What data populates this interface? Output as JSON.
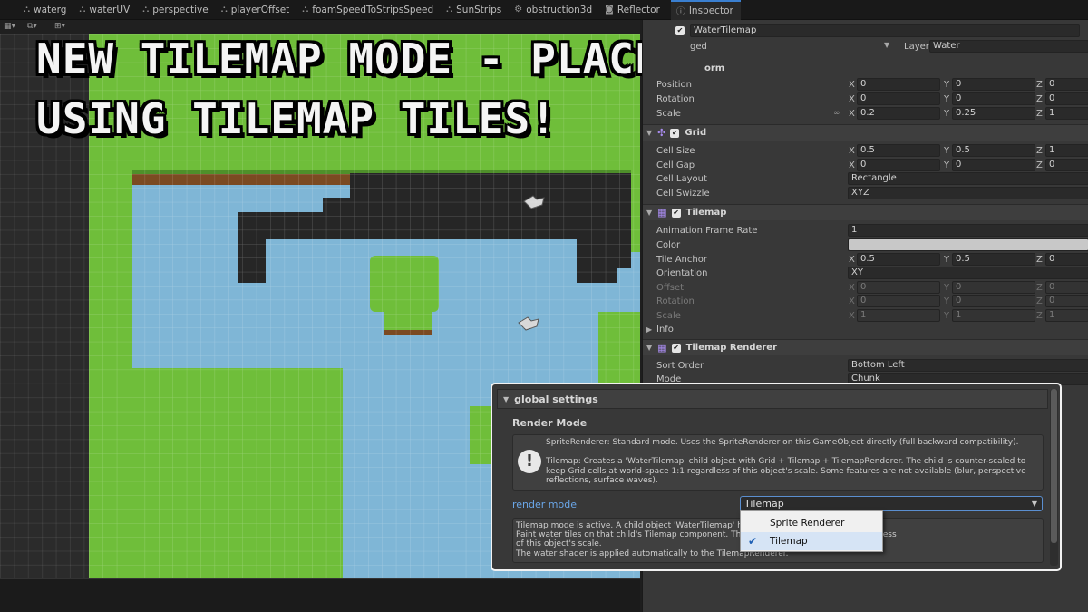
{
  "tabs": [
    {
      "label": "waterg",
      "icon": "shader-icon"
    },
    {
      "label": "waterUV",
      "icon": "shader-icon"
    },
    {
      "label": "perspective",
      "icon": "shader-icon"
    },
    {
      "label": "playerOffset",
      "icon": "shader-icon"
    },
    {
      "label": "foamSpeedToStripsSpeed",
      "icon": "shader-icon"
    },
    {
      "label": "SunStrips",
      "icon": "shader-icon"
    },
    {
      "label": "obstruction3d",
      "icon": "gear-icon"
    },
    {
      "label": "Reflector",
      "icon": "camera-icon"
    },
    {
      "label": "Inspector",
      "icon": "info-icon"
    }
  ],
  "overlay_title": {
    "line1": "NEW TILEMAP MODE - PLACE WATER",
    "line2": "USING TILEMAP TILES!"
  },
  "inspector": {
    "object_name": "WaterTilemap",
    "tag_label": "ged",
    "layer_label": "Layer",
    "layer_value": "Water",
    "transform_header_fragment": "orm",
    "transform": {
      "position_label": "Position",
      "rotation_label": "Rotation",
      "scale_label": "Scale",
      "position": [
        "0",
        "0",
        "0"
      ],
      "rotation": [
        "0",
        "0",
        "0"
      ],
      "scale": [
        "0.2",
        "0.25",
        "1"
      ]
    },
    "grid": {
      "header": "Grid",
      "cell_size_label": "Cell Size",
      "cell_size": [
        "0.5",
        "0.5",
        "1"
      ],
      "cell_gap_label": "Cell Gap",
      "cell_gap": [
        "0",
        "0",
        "0"
      ],
      "cell_layout_label": "Cell Layout",
      "cell_layout": "Rectangle",
      "cell_swizzle_label": "Cell Swizzle",
      "cell_swizzle": "XYZ"
    },
    "tilemap": {
      "header": "Tilemap",
      "animation_frame_rate_label": "Animation Frame Rate",
      "animation_frame_rate": "1",
      "color_label": "Color",
      "color_value": "#c8c8c8",
      "tile_anchor_label": "Tile Anchor",
      "tile_anchor": [
        "0.5",
        "0.5",
        "0"
      ],
      "orientation_label": "Orientation",
      "orientation": "XY",
      "offset_label": "Offset",
      "offset": [
        "0",
        "0",
        "0"
      ],
      "rotation_label": "Rotation",
      "rotation": [
        "0",
        "0",
        "0"
      ],
      "scale_label": "Scale",
      "scale": [
        "1",
        "1",
        "1"
      ],
      "info_label": "Info"
    },
    "renderer": {
      "header": "Tilemap Renderer",
      "sort_order_label": "Sort Order",
      "sort_order": "Bottom Left",
      "mode_label": "Mode",
      "mode": "Chunk"
    }
  },
  "global_settings": {
    "header": "global settings",
    "render_mode_title": "Render Mode",
    "help_text": "SpriteRenderer: Standard mode. Uses the SpriteRenderer on this GameObject directly (full backward compatibility).\n\nTilemap: Creates a 'WaterTilemap' child object with Grid + Tilemap + TilemapRenderer. The child is counter-scaled to keep Grid cells at world-space 1:1 regardless of this object's scale. Some features are not available (blur, perspective reflections, surface waves).",
    "render_mode_label": "render mode",
    "render_mode_value": "Tilemap",
    "info_text": "Tilemap mode is active. A child object 'WaterTilemap' ho                                              nderer.\nPaint water tiles on that child's Tilemap component. The                                              s stay at world-space 1:1 regardless\nof this object's scale.\nThe water shader is applied automatically to the TilemapRenderer.",
    "dropdown_options": [
      {
        "label": "Sprite Renderer",
        "selected": false
      },
      {
        "label": "Tilemap",
        "selected": true
      }
    ]
  },
  "colors": {
    "grass": "#6fbe3a",
    "water": "#7fb6d6",
    "dark_path": "#262626",
    "accent_blue": "#6aa6e8",
    "selection_outline": "#f2f2f2"
  }
}
